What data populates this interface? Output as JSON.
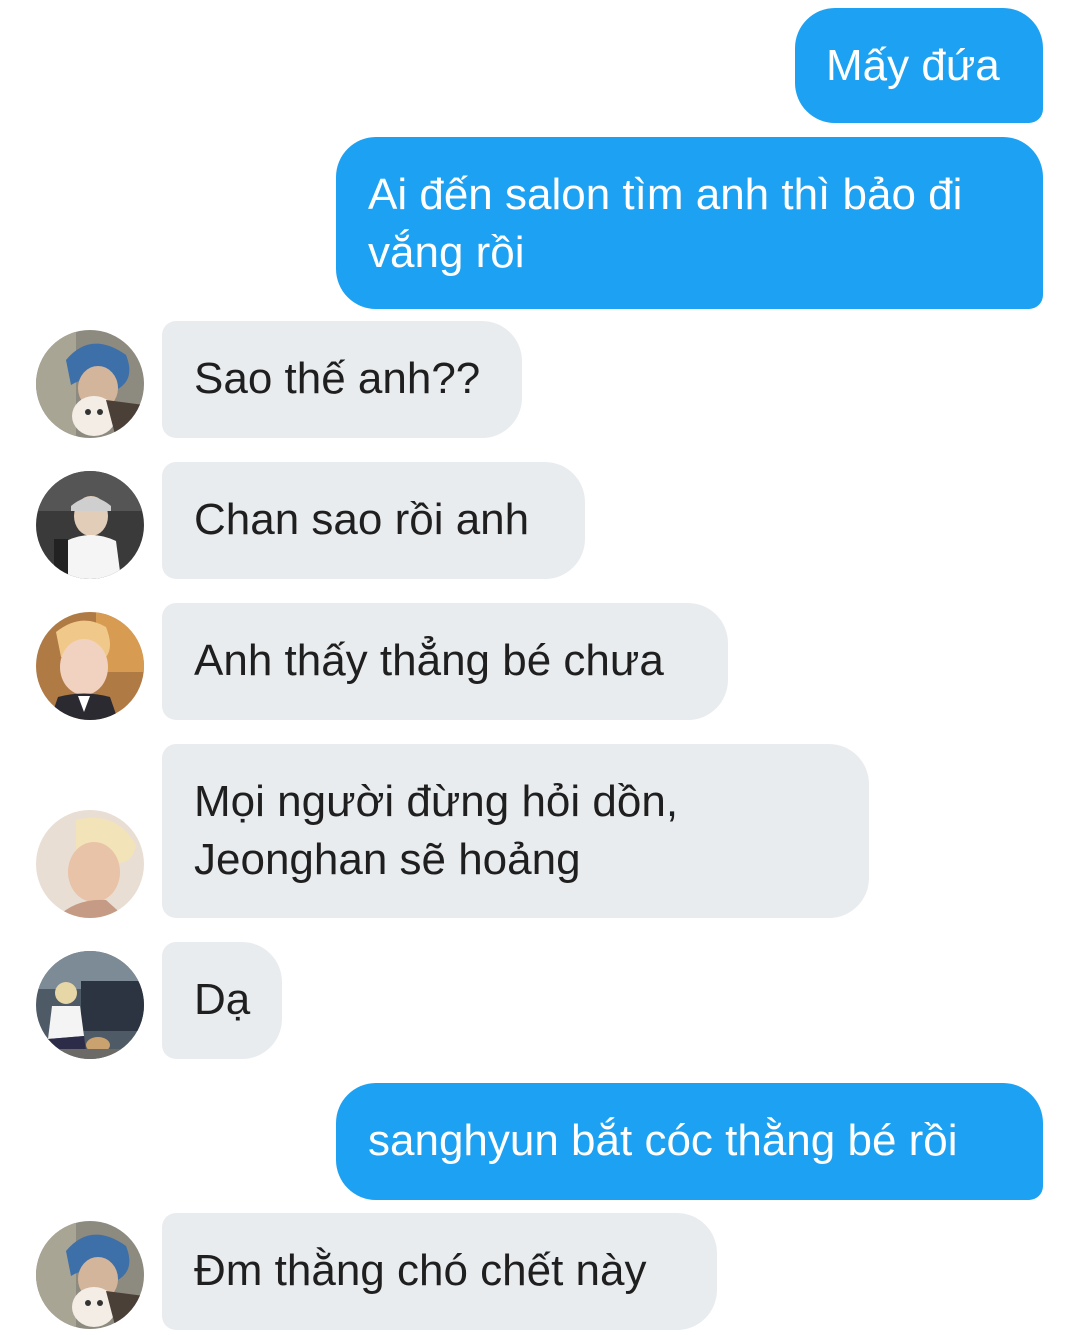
{
  "messages": [
    {
      "id": "m1",
      "direction": "outgoing",
      "text": "Mấy đứa"
    },
    {
      "id": "m2",
      "direction": "outgoing",
      "text": "Ai đến salon tìm anh thì bảo đi vắng rồi"
    },
    {
      "id": "m3",
      "direction": "incoming",
      "text": "Sao thế anh??",
      "avatar": "avatar-blue-hair-with-dog"
    },
    {
      "id": "m4",
      "direction": "incoming",
      "text": "Chan sao rồi anh",
      "avatar": "avatar-white-shirt-cap"
    },
    {
      "id": "m5",
      "direction": "incoming",
      "text": "Anh thấy thẳng bé chưa",
      "avatar": "avatar-blond-selfie"
    },
    {
      "id": "m6",
      "direction": "incoming",
      "text": "Mọi người đừng hỏi dồn, Jeonghan sẽ hoảng",
      "avatar": "avatar-blond-profile"
    },
    {
      "id": "m7",
      "direction": "incoming",
      "text": "Dạ",
      "avatar": "avatar-crouching-with-dog"
    },
    {
      "id": "m8",
      "direction": "outgoing",
      "text": "sanghyun bắt cóc thằng bé rồi"
    },
    {
      "id": "m9",
      "direction": "incoming",
      "text": "Đm thằng chó chết này",
      "avatar": "avatar-blue-hair-with-dog"
    }
  ],
  "colors": {
    "outgoing_bubble": "#1da1f2",
    "outgoing_text": "#ffffff",
    "incoming_bubble": "#e9ecef",
    "incoming_text": "#1f1f1f",
    "background": "#ffffff"
  }
}
